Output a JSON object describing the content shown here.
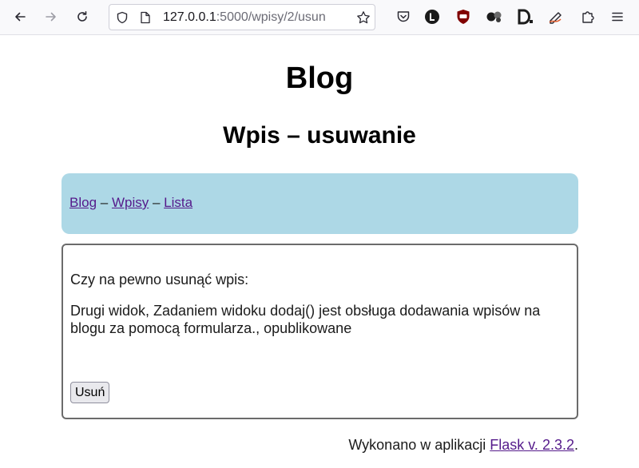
{
  "browser": {
    "url_host": "127.0.0.1",
    "url_rest": ":5000/wpisy/2/usun"
  },
  "page": {
    "title": "Blog",
    "subtitle": "Wpis – usuwanie"
  },
  "nav": {
    "items": [
      {
        "label": "Blog"
      },
      {
        "label": "Wpisy"
      },
      {
        "label": "Lista"
      }
    ],
    "separator": " – "
  },
  "form": {
    "question": "Czy na pewno usunąć wpis:",
    "entry": "Drugi widok, Zadaniem widoku dodaj() jest obsługa dodawania wpisów na blogu za pomocą formularza., opublikowane",
    "delete_label": "Usuń"
  },
  "footer": {
    "prefix": "Wykonano w aplikacji ",
    "link": "Flask v. 2.3.2",
    "suffix": "."
  },
  "colors": {
    "nav_background": "#add8e6",
    "link": "#551a8b"
  }
}
